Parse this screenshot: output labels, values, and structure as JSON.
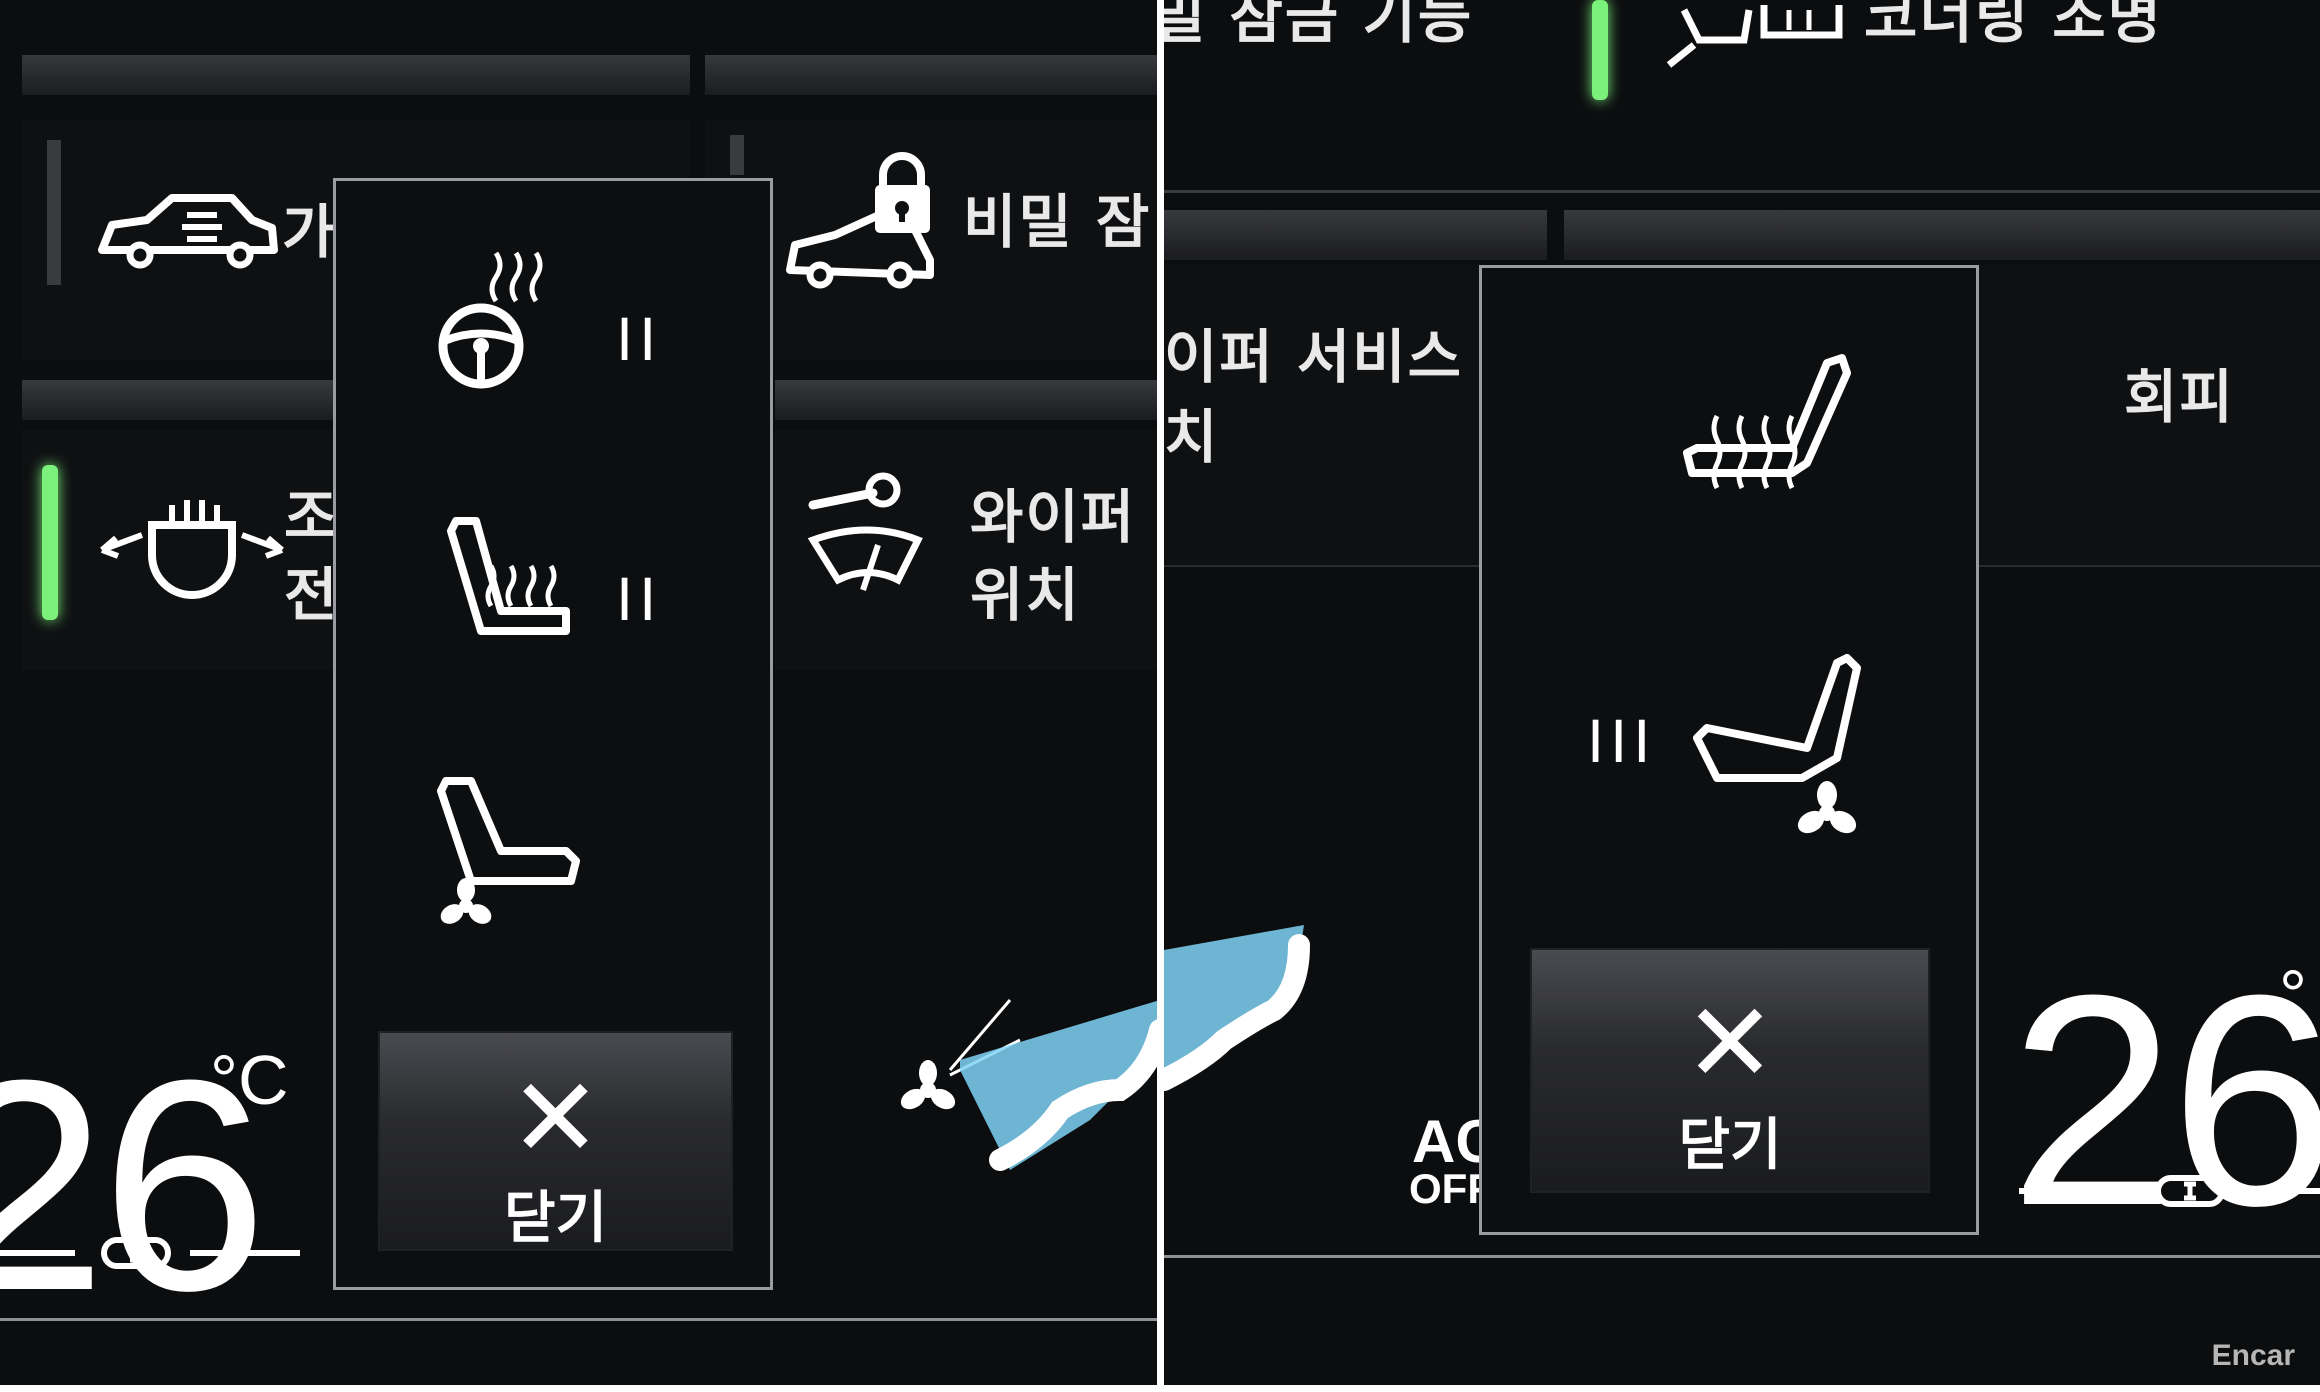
{
  "left": {
    "tiles": {
      "drive_label": "가",
      "secret_lock_label": "비밀 잠",
      "light_label_line1": "조",
      "light_label_line2": "전",
      "wiper_label_line1": "와이퍼",
      "wiper_label_line2": "위치"
    },
    "popup": {
      "steering_heat_level": "II",
      "seat_heat_level": "II",
      "close_label": "닫기"
    },
    "climate": {
      "temperature": "26",
      "unit": "°C"
    }
  },
  "right": {
    "tiles": {
      "top_left_label": "밀 잠금 기능",
      "top_right_label": "코너링 조명",
      "wiper_service_line1": "이퍼 서비스",
      "wiper_service_line2": "치",
      "avoid_label": "회피"
    },
    "popup": {
      "seat_vent_level": "III",
      "close_label": "닫기"
    },
    "climate": {
      "temperature": "26",
      "unit": "°",
      "ac_line1": "AC",
      "ac_line2": "OFF"
    }
  },
  "watermark": "Encar",
  "colors": {
    "active_indicator": "#7bf07b",
    "airflow": "#7fd3f5"
  }
}
